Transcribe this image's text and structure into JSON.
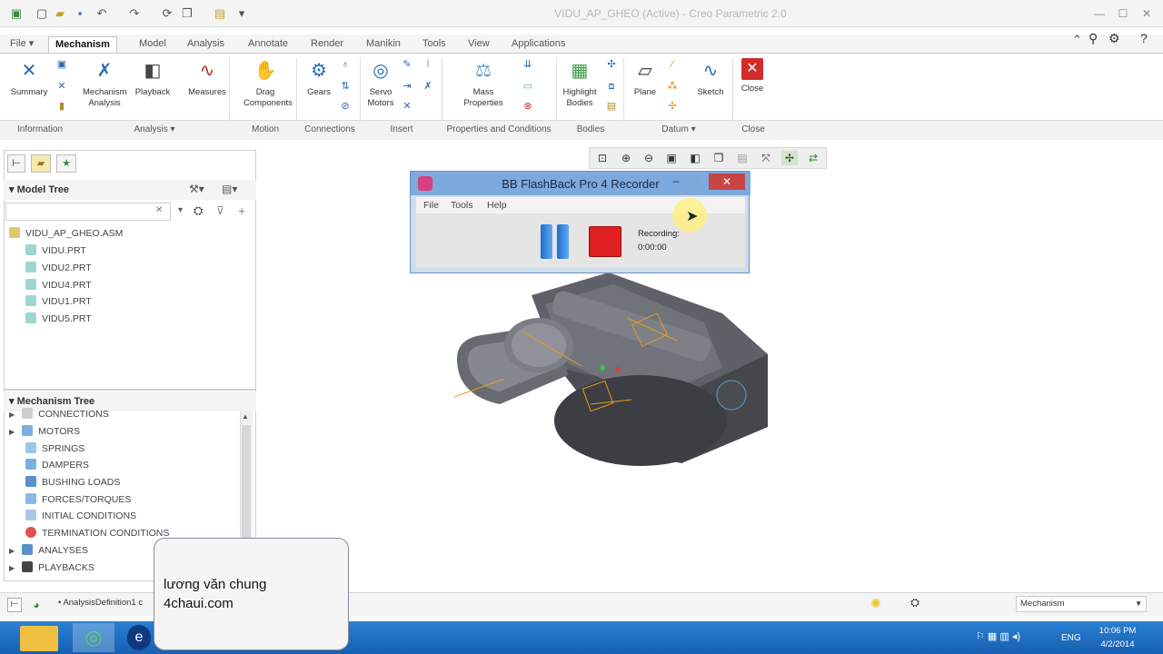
{
  "app": {
    "window_title": "VIDU_AP_GHEO (Active) - Creo Parametric 2.0"
  },
  "tabs": [
    {
      "label": "File",
      "dropdown": "▾"
    },
    {
      "label": "Mechanism"
    },
    {
      "label": "Model"
    },
    {
      "label": "Analysis"
    },
    {
      "label": "Annotate"
    },
    {
      "label": "Render"
    },
    {
      "label": "Manikin"
    },
    {
      "label": "Tools"
    },
    {
      "label": "View"
    },
    {
      "label": "Applications"
    }
  ],
  "ribbon": {
    "buttons": {
      "summary": "Summary",
      "mech_analysis": "Mechanism Analysis",
      "playback": "Playback",
      "measures": "Measures",
      "drag": "Drag Components",
      "gears": "Gears",
      "servo": "Servo Motors",
      "mass": "Mass Properties",
      "highlight": "Highlight Bodies",
      "plane": "Plane",
      "sketch": "Sketch",
      "close": "Close"
    },
    "groups": {
      "information": "Information",
      "analysis": "Analysis ▾",
      "motion": "Motion",
      "connections": "Connections",
      "insert": "Insert",
      "properties": "Properties and Conditions",
      "bodies": "Bodies",
      "datum": "Datum ▾",
      "close": "Close"
    }
  },
  "model_tree": {
    "header": "Model Tree",
    "search_value": "",
    "items": [
      "VIDU_AP_GHEO.ASM",
      "VIDU.PRT",
      "VIDU2.PRT",
      "VIDU4.PRT",
      "VIDU1.PRT",
      "VIDU5.PRT"
    ]
  },
  "mechanism_tree": {
    "header": "Mechanism Tree",
    "items": [
      "CONNECTIONS",
      "MOTORS",
      "SPRINGS",
      "DAMPERS",
      "BUSHING LOADS",
      "FORCES/TORQUES",
      "INITIAL CONDITIONS",
      "TERMINATION CONDITIONS",
      "ANALYSES",
      "PLAYBACKS"
    ]
  },
  "recorder": {
    "title": "BB FlashBack Pro 4 Recorder",
    "menu": [
      "File",
      "Tools",
      "Help"
    ],
    "status_label": "Recording:",
    "status_time": "0:00:00"
  },
  "statusbar": {
    "message": "• AnalysisDefinition1 c",
    "mode": "Mechanism"
  },
  "watermark": {
    "line1": "lương văn chung",
    "line2": "4chaui.com"
  },
  "taskbar": {
    "lang": "ENG",
    "time": "10:06 PM",
    "date": "4/2/2014"
  },
  "colors": {
    "accent": "#2a6ab0",
    "recorder_title": "#7ea9dc",
    "record_red": "#e02020",
    "taskbar": "#1f6fc4"
  }
}
